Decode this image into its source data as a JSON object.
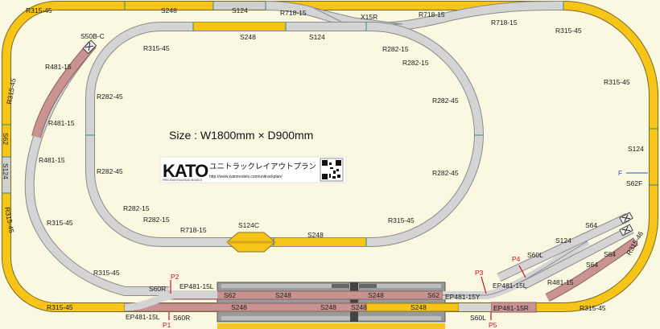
{
  "size_text": "Size : W1800mm × D900mm",
  "logo": {
    "brand": "KATO",
    "brand_sub": "PRECISION RAILROAD MODELS",
    "title_jp": "ユニトラックレイアウトプラン",
    "url": "http://www.katomodels.com/unitrackplan/"
  },
  "colors": {
    "straight_248": "#f7c518",
    "curve_r315": "#f7c518",
    "curve_r282": "#d4d4d4",
    "curve_r481": "#c99392",
    "platform": "#9a9a9a",
    "background": "#fbf8e1",
    "marker_red": "#d0101a",
    "marker_blue": "#2050d0"
  },
  "labels": {
    "tl_r315": "R315-45",
    "top_s248": "S248",
    "top_s124": "S124",
    "top_r718_l": "R718-15",
    "x15r": "X15R",
    "top_r718_r": "R718-15",
    "top_r718_r2": "R718-15",
    "tr_r315": "R315-45",
    "in_s248": "S248",
    "in_s124": "S124",
    "r282_a": "R282-15",
    "r282_b": "R282-15",
    "r282_45_r1": "R282-45",
    "r282_45_r2": "R282-45",
    "r315_right": "R315-45",
    "s124_right": "S124",
    "f_marker": "F",
    "s62f": "S62F",
    "s50b": "S50B-C",
    "r481_1": "R481-15",
    "r481_2": "R481-15",
    "r481_3": "R481-15",
    "l_r315_45": "R315-45",
    "l_s62": "S62",
    "l_s124": "S124",
    "l_r315_45b": "R315-45",
    "in_r282_45_l1": "R282-45",
    "in_r282_45_l2": "R282-45",
    "in_r315_45_l": "R315-45",
    "r282_15_bl1": "R282-15",
    "r282_15_bl2": "R282-15",
    "r718_bot": "R718-15",
    "s124c": "S124C",
    "bot_s248": "S248",
    "r315_45_bot": "R315-45",
    "r315_45_ll": "R315-45",
    "r315_45_bl": "R315-45",
    "p2": "P2",
    "s60r_top": "S60R",
    "ep481_15l_top": "EP481-15L",
    "s62_a": "S62",
    "s248_a": "S248",
    "s248_b": "S248",
    "s62_b": "S62",
    "ep481_15y": "EP481-15Y",
    "s248_lo1": "S248",
    "s248_lo2": "S248",
    "s248_lo3": "S248",
    "s248_lo4": "S248",
    "ep481_15l_bot": "EP481-15L",
    "p1": "P1",
    "s60r_bot": "S60R",
    "p3": "P3",
    "ep481_15l_r": "EP481-15L",
    "p4": "P4",
    "s60l_top": "S60L",
    "s60l_bot": "S60L",
    "p5": "P5",
    "ep481_15r": "EP481-15R",
    "r315_45_br": "R315-45",
    "r481_15_r": "R481-15",
    "s64_a": "S64",
    "s124_yard": "S124",
    "s64_b": "S64",
    "s64_c": "S64",
    "r315_45_ry": "R315-45",
    "r315_46_r": "R315-46"
  }
}
